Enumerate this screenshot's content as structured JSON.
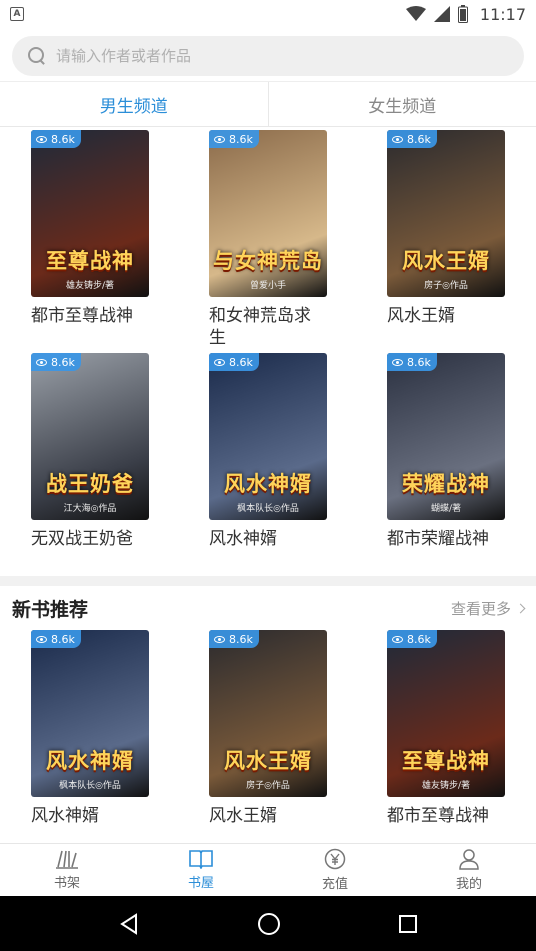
{
  "status_bar": {
    "app_icon_letter": "A",
    "time": "11:17"
  },
  "search": {
    "placeholder": "请输入作者或者作品"
  },
  "tabs": [
    {
      "label": "男生频道",
      "active": true
    },
    {
      "label": "女生频道",
      "active": false
    }
  ],
  "main_grid": [
    {
      "title": "都市至尊战神",
      "views": "8.6k",
      "cover_text": "至尊战神",
      "cover_sub": "雄友铸步/著",
      "cover_colors": [
        "#1e2a3a",
        "#6b2a1a"
      ]
    },
    {
      "title": "和女神荒岛求生",
      "views": "8.6k",
      "cover_text": "与女神荒岛",
      "cover_sub": "曾爱小手",
      "cover_colors": [
        "#8a6a4a",
        "#d6b88a"
      ]
    },
    {
      "title": "风水王婿",
      "views": "8.6k",
      "cover_text": "风水王婿",
      "cover_sub": "房子◎作品",
      "cover_colors": [
        "#2a2a2e",
        "#7a5a3a"
      ]
    },
    {
      "title": "无双战王奶爸",
      "views": "8.6k",
      "cover_text": "战王奶爸",
      "cover_sub": "江大海◎作品",
      "cover_colors": [
        "#9aa0a8",
        "#3a3e48"
      ]
    },
    {
      "title": "风水神婿",
      "views": "8.6k",
      "cover_text": "风水神婿",
      "cover_sub": "枫本队长◎作品",
      "cover_colors": [
        "#1a2a4a",
        "#5a6a8a"
      ]
    },
    {
      "title": "都市荣耀战神",
      "views": "8.6k",
      "cover_text": "荣耀战神",
      "cover_sub": "蝴蝶/著",
      "cover_colors": [
        "#2a3040",
        "#6a7080"
      ]
    }
  ],
  "new_books": {
    "title": "新书推荐",
    "more_label": "查看更多",
    "items": [
      {
        "title": "风水神婿",
        "views": "8.6k",
        "cover_text": "风水神婿",
        "cover_sub": "枫本队长◎作品",
        "cover_colors": [
          "#1a2a4a",
          "#5a6a8a"
        ]
      },
      {
        "title": "风水王婿",
        "views": "8.6k",
        "cover_text": "风水王婿",
        "cover_sub": "房子◎作品",
        "cover_colors": [
          "#2a2a2e",
          "#7a5a3a"
        ]
      },
      {
        "title": "都市至尊战神",
        "views": "8.6k",
        "cover_text": "至尊战神",
        "cover_sub": "雄友铸步/著",
        "cover_colors": [
          "#1e2a3a",
          "#6b2a1a"
        ]
      }
    ]
  },
  "bottom_nav": [
    {
      "label": "书架",
      "icon": "bookshelf-icon",
      "active": false
    },
    {
      "label": "书屋",
      "icon": "book-open-icon",
      "active": true
    },
    {
      "label": "充值",
      "icon": "yen-icon",
      "active": false
    },
    {
      "label": "我的",
      "icon": "person-icon",
      "active": false
    }
  ],
  "colors": {
    "accent": "#2b8ed8",
    "badge": "#3a96e6"
  }
}
